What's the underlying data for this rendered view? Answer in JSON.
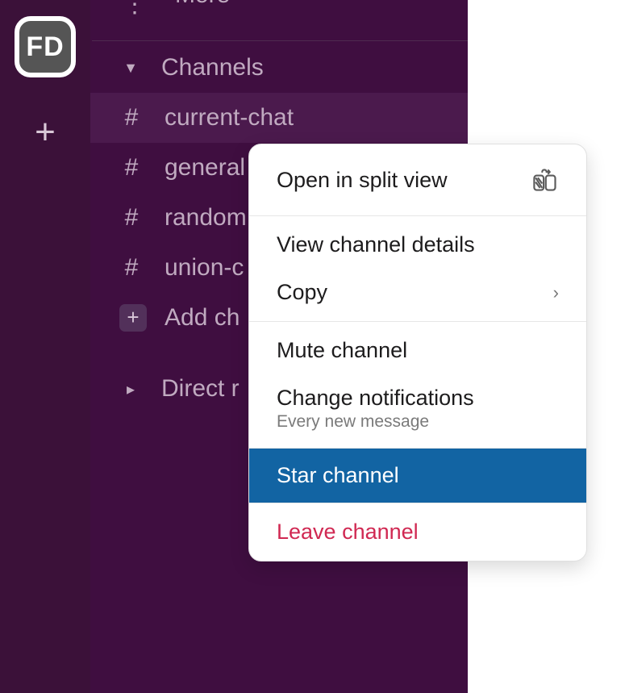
{
  "workspace_initials": "FD",
  "more_label": "More",
  "sections": {
    "channels": {
      "label": "Channels",
      "items": [
        {
          "name": "current-chat",
          "selected": true
        },
        {
          "name": "general",
          "selected": false
        },
        {
          "name": "random",
          "selected": false
        },
        {
          "name": "union-c",
          "selected": false
        }
      ],
      "add_label": "Add ch"
    },
    "direct": {
      "label": "Direct r"
    }
  },
  "context_menu": {
    "open_split": "Open in split view",
    "view_details": "View channel details",
    "copy": "Copy",
    "mute": "Mute channel",
    "change_notifications": "Change notifications",
    "change_notifications_sub": "Every new message",
    "star": "Star channel",
    "leave": "Leave channel"
  }
}
